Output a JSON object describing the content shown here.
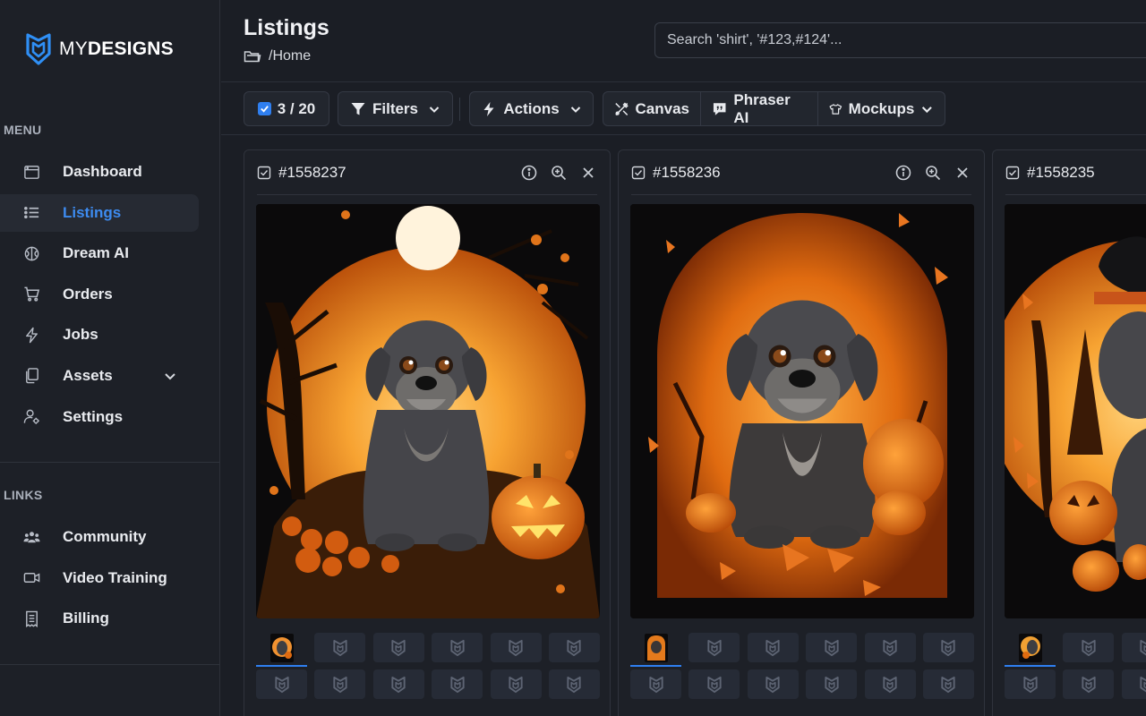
{
  "brand": {
    "name_thin": "MY",
    "name_bold": "DESIGNS"
  },
  "sidebar": {
    "menu_label": "MENU",
    "menu_items": [
      {
        "label": "Dashboard",
        "icon": "dashboard-icon",
        "active": false
      },
      {
        "label": "Listings",
        "icon": "list-icon",
        "active": true
      },
      {
        "label": "Dream AI",
        "icon": "brain-icon",
        "active": false
      },
      {
        "label": "Orders",
        "icon": "cart-icon",
        "active": false
      },
      {
        "label": "Jobs",
        "icon": "bolt-icon",
        "active": false
      },
      {
        "label": "Assets",
        "icon": "files-icon",
        "active": false,
        "expandable": true
      },
      {
        "label": "Settings",
        "icon": "user-gear-icon",
        "active": false
      }
    ],
    "links_label": "LINKS",
    "link_items": [
      {
        "label": "Community",
        "icon": "users-icon"
      },
      {
        "label": "Video Training",
        "icon": "video-icon"
      },
      {
        "label": "Billing",
        "icon": "receipt-icon"
      }
    ]
  },
  "header": {
    "title": "Listings",
    "breadcrumb": "/Home",
    "search_placeholder": "Search 'shirt', '#123,#124'..."
  },
  "toolbar": {
    "selection": "3 / 20",
    "filters": "Filters",
    "actions": "Actions",
    "canvas": "Canvas",
    "phraser": "Phraser AI",
    "mockups": "Mockups"
  },
  "cards": [
    {
      "id": "#1558237",
      "thumb_count": 12
    },
    {
      "id": "#1558236",
      "thumb_count": 12
    },
    {
      "id": "#1558235",
      "thumb_count": 12
    }
  ],
  "colors": {
    "accent": "#2f7ff0",
    "background": "#1b1e25",
    "sidebar": "#1d2027",
    "orange": "#f08a1c"
  }
}
